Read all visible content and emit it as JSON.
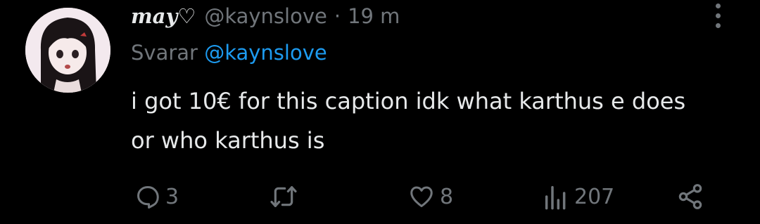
{
  "tweet": {
    "display_name": "may♡",
    "handle": "@kaynslove",
    "separator": "·",
    "time": "19 m",
    "reply_prefix": "Svarar",
    "reply_to": "@kaynslove",
    "text": "i got 10€ for this caption idk what karthus e does or who karthus is"
  },
  "actions": {
    "reply_count": "3",
    "retweet_count": "",
    "like_count": "8",
    "views_count": "207"
  },
  "icons": {
    "reply": "comment-bubble-icon",
    "retweet": "retweet-arrows-icon",
    "like": "heart-icon",
    "views": "bar-chart-icon",
    "share": "share-icon",
    "more": "vertical-dots-icon"
  },
  "colors": {
    "background": "#000000",
    "primary_text": "#e7e9ea",
    "secondary_text": "#71767b",
    "link": "#1d9bf0"
  }
}
